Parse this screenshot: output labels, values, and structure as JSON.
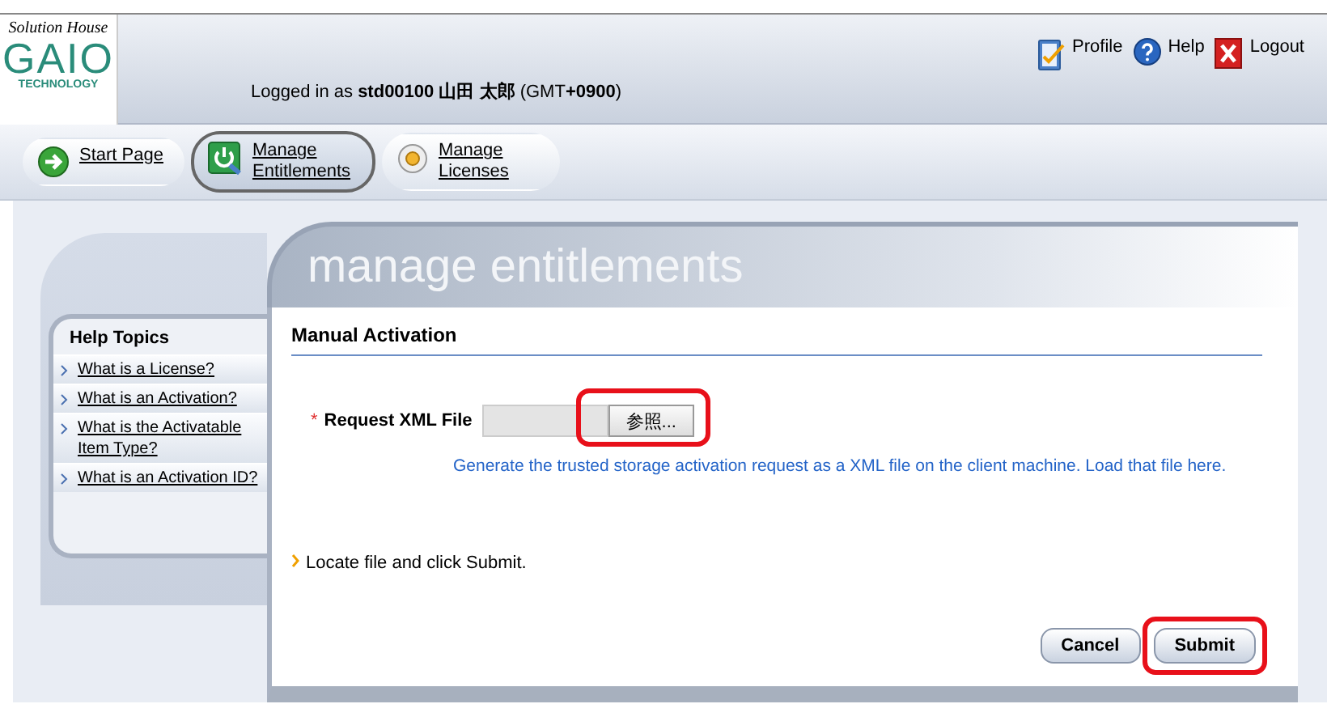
{
  "header": {
    "logo_script": "Solution House",
    "logo_name": "GAIO",
    "logo_sub": "TECHNOLOGY",
    "login_text": "Logged in as **std00100 山田 太郎** (GMT**+0900**)"
  },
  "header_links": [
    {
      "label": "Profile",
      "kind": "profile"
    },
    {
      "label": "Help",
      "kind": "help"
    },
    {
      "label": "Logout",
      "kind": "logout"
    }
  ],
  "nav": [
    {
      "label": "Start Page",
      "kind": "start",
      "selected": false
    },
    {
      "label": "Manage Entitlements",
      "kind": "entitlements",
      "selected": true
    },
    {
      "label": "Manage Licenses",
      "kind": "licenses",
      "selected": false
    }
  ],
  "help_topics": {
    "title": "Help Topics",
    "items": [
      "What is a License?",
      "What is an Activation?",
      "What is the Activatable Item Type?",
      "What is an Activation ID?"
    ]
  },
  "main": {
    "page_title": "manage entitlements",
    "section_title": "Manual Activation",
    "field": {
      "required_mark": "*",
      "label": "Request XML File",
      "browse_button": "参照...",
      "browse_highlighted": true,
      "hint": "Generate the trusted storage activation request as a XML file on the client machine. Load that file here."
    },
    "instruction": "Locate file and click Submit.",
    "buttons": [
      {
        "label": "Cancel",
        "highlighted": false
      },
      {
        "label": "Submit",
        "highlighted": true
      }
    ]
  }
}
